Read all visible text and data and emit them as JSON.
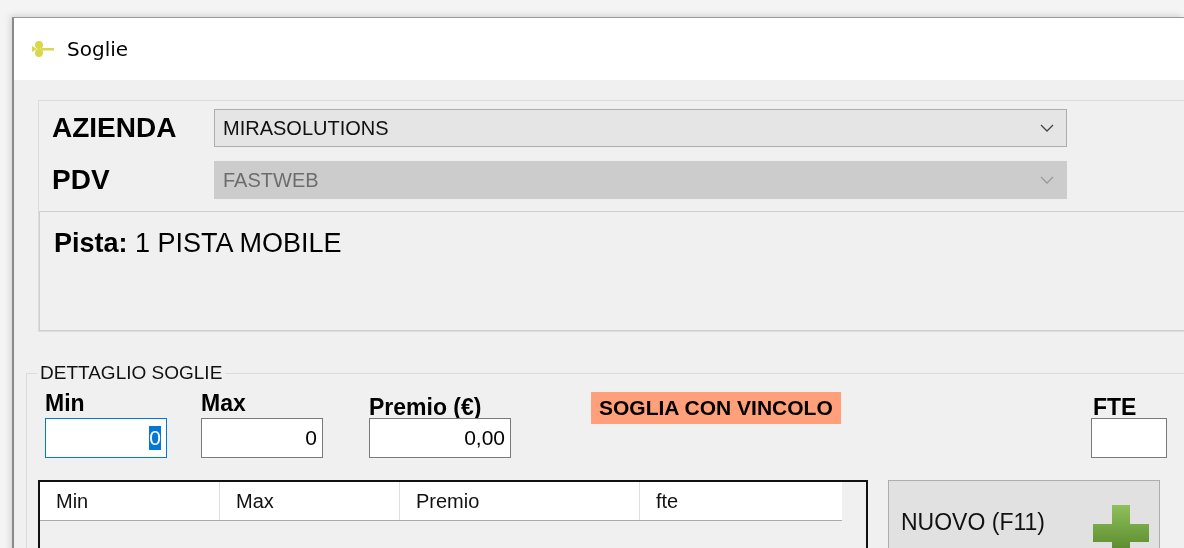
{
  "window": {
    "title": "Soglie"
  },
  "selectors": [
    {
      "label": "AZIENDA",
      "value": "MIRASOLUTIONS",
      "disabled": false
    },
    {
      "label": "PDV",
      "value": "FASTWEB",
      "disabled": true
    }
  ],
  "pista": {
    "label": "Pista:",
    "value": "1 PISTA MOBILE"
  },
  "detail": {
    "title": "DETTAGLIO SOGLIE",
    "fields": [
      {
        "label": "Min",
        "value": "0",
        "focused": true
      },
      {
        "label": "Max",
        "value": "0",
        "focused": false
      },
      {
        "label": "Premio (€)",
        "value": "0,00",
        "focused": false
      }
    ],
    "badge": "SOGLIA CON VINCOLO",
    "fte": {
      "label": "FTE"
    },
    "table": {
      "columns": [
        "Min",
        "Max",
        "Premio",
        "fte"
      ]
    },
    "new_button": "NUOVO (F11)"
  }
}
